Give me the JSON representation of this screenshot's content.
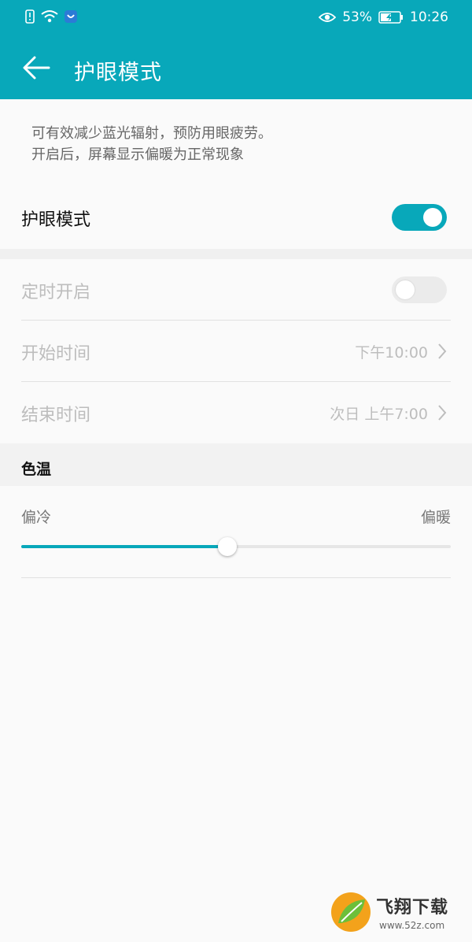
{
  "status_bar": {
    "battery_percent": "53%",
    "time": "10:26",
    "icons": [
      "sim-alert-icon",
      "wifi-icon",
      "app-notification-icon",
      "eye-comfort-icon",
      "battery-charging-icon"
    ]
  },
  "app_bar": {
    "title": "护眼模式",
    "back_icon": "arrow-left-icon"
  },
  "description": {
    "line1": "可有效减少蓝光辐射，预防用眼疲劳。",
    "line2": "开启后，屏幕显示偏暖为正常现象"
  },
  "eye_mode": {
    "label": "护眼模式",
    "enabled": true
  },
  "schedule": {
    "label": "定时开启",
    "enabled": false,
    "start": {
      "label": "开始时间",
      "value": "下午10:00"
    },
    "end": {
      "label": "结束时间",
      "value": "次日 上午7:00"
    }
  },
  "color_temp": {
    "header": "色温",
    "min_label": "偏冷",
    "max_label": "偏暖",
    "level": 0.48
  },
  "colors": {
    "accent": "#08a8ba",
    "disabled_text": "#bdbdbd"
  },
  "watermark": {
    "brand": "飞翔下载",
    "url": "www.52z.com"
  }
}
